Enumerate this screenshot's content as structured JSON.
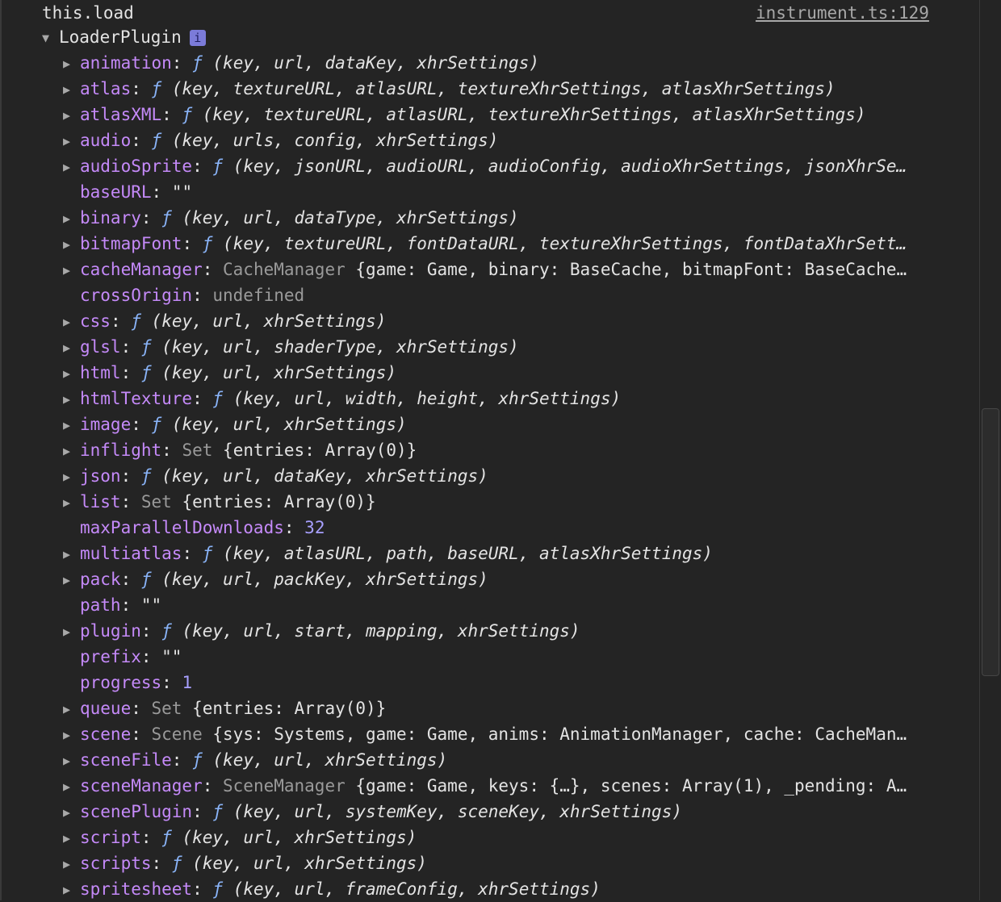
{
  "console": {
    "message": "this.load",
    "source": "instrument.ts:129",
    "root_label": "LoaderPlugin",
    "info_icon": "i"
  },
  "properties": [
    {
      "key": "animation",
      "type": "function",
      "expandable": true,
      "value": "(key, url, dataKey, xhrSettings)"
    },
    {
      "key": "atlas",
      "type": "function",
      "expandable": true,
      "value": "(key, textureURL, atlasURL, textureXhrSettings, atlasXhrSettings)"
    },
    {
      "key": "atlasXML",
      "type": "function",
      "expandable": true,
      "value": "(key, textureURL, atlasURL, textureXhrSettings, atlasXhrSettings)"
    },
    {
      "key": "audio",
      "type": "function",
      "expandable": true,
      "value": "(key, urls, config, xhrSettings)"
    },
    {
      "key": "audioSprite",
      "type": "function",
      "expandable": true,
      "value": "(key, jsonURL, audioURL, audioConfig, audioXhrSettings, jsonXhrSe…"
    },
    {
      "key": "baseURL",
      "type": "string",
      "expandable": false,
      "value": "\"\""
    },
    {
      "key": "binary",
      "type": "function",
      "expandable": true,
      "value": "(key, url, dataType, xhrSettings)"
    },
    {
      "key": "bitmapFont",
      "type": "function",
      "expandable": true,
      "value": "(key, textureURL, fontDataURL, textureXhrSettings, fontDataXhrSett…"
    },
    {
      "key": "cacheManager",
      "type": "object",
      "expandable": true,
      "class": "CacheManager",
      "value": "{game: Game, binary: BaseCache, bitmapFont: BaseCache…"
    },
    {
      "key": "crossOrigin",
      "type": "undefined",
      "expandable": false,
      "value": "undefined"
    },
    {
      "key": "css",
      "type": "function",
      "expandable": true,
      "value": "(key, url, xhrSettings)"
    },
    {
      "key": "glsl",
      "type": "function",
      "expandable": true,
      "value": "(key, url, shaderType, xhrSettings)"
    },
    {
      "key": "html",
      "type": "function",
      "expandable": true,
      "value": "(key, url, xhrSettings)"
    },
    {
      "key": "htmlTexture",
      "type": "function",
      "expandable": true,
      "value": "(key, url, width, height, xhrSettings)"
    },
    {
      "key": "image",
      "type": "function",
      "expandable": true,
      "value": "(key, url, xhrSettings)"
    },
    {
      "key": "inflight",
      "type": "object",
      "expandable": true,
      "class": "Set",
      "value": "{entries: Array(0)}"
    },
    {
      "key": "json",
      "type": "function",
      "expandable": true,
      "value": "(key, url, dataKey, xhrSettings)"
    },
    {
      "key": "list",
      "type": "object",
      "expandable": true,
      "class": "Set",
      "value": "{entries: Array(0)}"
    },
    {
      "key": "maxParallelDownloads",
      "type": "number",
      "expandable": false,
      "value": "32"
    },
    {
      "key": "multiatlas",
      "type": "function",
      "expandable": true,
      "value": "(key, atlasURL, path, baseURL, atlasXhrSettings)"
    },
    {
      "key": "pack",
      "type": "function",
      "expandable": true,
      "value": "(key, url, packKey, xhrSettings)"
    },
    {
      "key": "path",
      "type": "string",
      "expandable": false,
      "value": "\"\""
    },
    {
      "key": "plugin",
      "type": "function",
      "expandable": true,
      "value": "(key, url, start, mapping, xhrSettings)"
    },
    {
      "key": "prefix",
      "type": "string",
      "expandable": false,
      "value": "\"\""
    },
    {
      "key": "progress",
      "type": "number",
      "expandable": false,
      "value": "1"
    },
    {
      "key": "queue",
      "type": "object",
      "expandable": true,
      "class": "Set",
      "value": "{entries: Array(0)}"
    },
    {
      "key": "scene",
      "type": "object",
      "expandable": true,
      "class": "Scene",
      "value": "{sys: Systems, game: Game, anims: AnimationManager, cache: CacheMan…"
    },
    {
      "key": "sceneFile",
      "type": "function",
      "expandable": true,
      "value": "(key, url, xhrSettings)"
    },
    {
      "key": "sceneManager",
      "type": "object",
      "expandable": true,
      "class": "SceneManager",
      "value": "{game: Game, keys: {…}, scenes: Array(1), _pending: A…"
    },
    {
      "key": "scenePlugin",
      "type": "function",
      "expandable": true,
      "value": "(key, url, systemKey, sceneKey, xhrSettings)"
    },
    {
      "key": "script",
      "type": "function",
      "expandable": true,
      "value": "(key, url, xhrSettings)"
    },
    {
      "key": "scripts",
      "type": "function",
      "expandable": true,
      "value": "(key, url, xhrSettings)"
    },
    {
      "key": "spritesheet",
      "type": "function",
      "expandable": true,
      "value": "(key, url, frameConfig, xhrSettings)"
    }
  ],
  "glyphs": {
    "function_marker": "ƒ",
    "expand_collapsed": "▶",
    "expand_open": "▼"
  },
  "colors": {
    "background": "#242424",
    "key": "#c58af9",
    "function": "#8ab4f8",
    "number": "#a8a0ff",
    "muted": "#9a9a9a"
  }
}
